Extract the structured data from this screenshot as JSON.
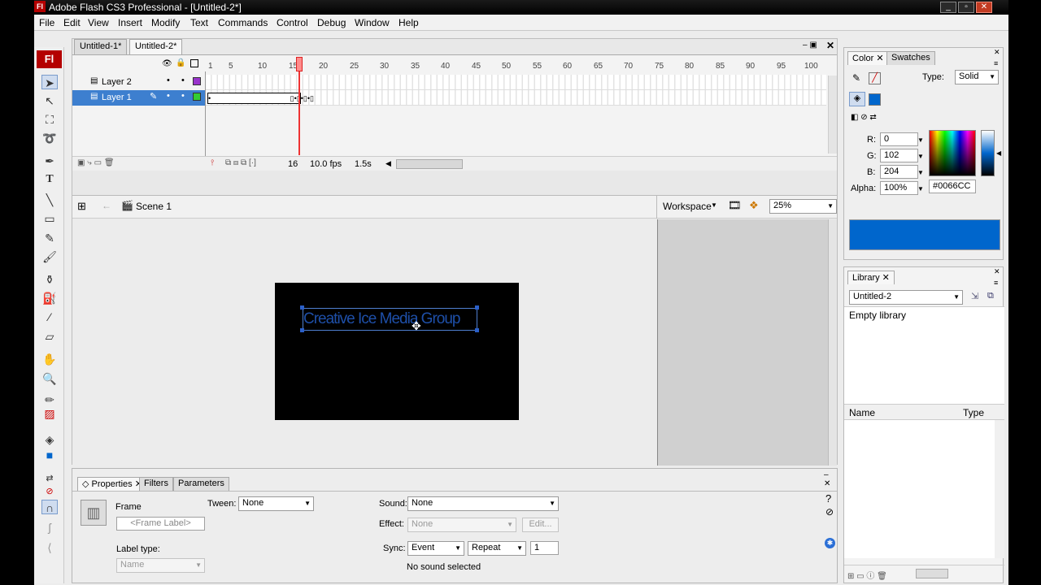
{
  "window": {
    "title": "Adobe Flash CS3 Professional - [Untitled-2*]",
    "logo": "Fl"
  },
  "menu": [
    "File",
    "Edit",
    "View",
    "Insert",
    "Modify",
    "Text",
    "Commands",
    "Control",
    "Debug",
    "Window",
    "Help"
  ],
  "tools": {
    "logo": "Fl"
  },
  "doc_tabs": [
    "Untitled-1*",
    "Untitled-2*"
  ],
  "timeline": {
    "frame_numbers": [
      "1",
      "5",
      "10",
      "15",
      "20",
      "25",
      "30",
      "35",
      "40",
      "45",
      "50",
      "55",
      "60",
      "65",
      "70",
      "75",
      "80",
      "85",
      "90",
      "95",
      "100"
    ],
    "layers": [
      {
        "name": "Layer 2"
      },
      {
        "name": "Layer 1"
      }
    ],
    "current_frame": "16",
    "fps": "10.0 fps",
    "time": "1.5s"
  },
  "scene": {
    "name": "Scene 1",
    "workspace": "Workspace",
    "zoom": "25%"
  },
  "stage": {
    "text": "Creative Ice Media Group",
    "text_color": "#1e4fa8"
  },
  "properties": {
    "tabs": [
      "Properties",
      "Filters",
      "Parameters"
    ],
    "frame_label": "Frame",
    "frame_label_placeholder": "<Frame Label>",
    "tween_label": "Tween:",
    "tween_value": "None",
    "label_type_label": "Label type:",
    "label_type_value": "Name",
    "sound_label": "Sound:",
    "sound_value": "None",
    "effect_label": "Effect:",
    "effect_value": "None",
    "edit_button": "Edit...",
    "sync_label": "Sync:",
    "sync_value": "Event",
    "repeat_value": "Repeat",
    "repeat_count": "1",
    "status": "No sound selected"
  },
  "color_panel": {
    "tabs": [
      "Color",
      "Swatches"
    ],
    "type_label": "Type:",
    "type_value": "Solid",
    "r_label": "R:",
    "r": "0",
    "g_label": "G:",
    "g": "102",
    "b_label": "B:",
    "b": "204",
    "alpha_label": "Alpha:",
    "alpha": "100%",
    "hex": "#0066CC",
    "swatch_color": "#0066CC"
  },
  "library_panel": {
    "tab": "Library",
    "document": "Untitled-2",
    "status": "Empty library",
    "col_name": "Name",
    "col_type": "Type"
  }
}
